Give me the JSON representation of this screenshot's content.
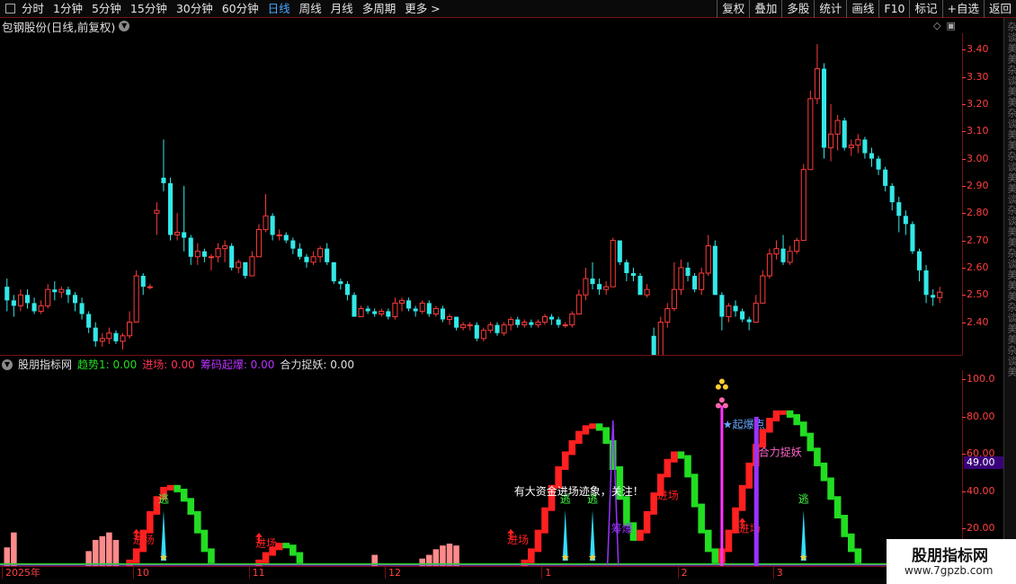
{
  "toolbar": {
    "tabs": [
      {
        "label": "分时",
        "active": false
      },
      {
        "label": "1分钟",
        "active": false
      },
      {
        "label": "5分钟",
        "active": false
      },
      {
        "label": "15分钟",
        "active": false
      },
      {
        "label": "30分钟",
        "active": false
      },
      {
        "label": "60分钟",
        "active": false
      },
      {
        "label": "日线",
        "active": true
      },
      {
        "label": "周线",
        "active": false
      },
      {
        "label": "月线",
        "active": false
      },
      {
        "label": "多周期",
        "active": false
      },
      {
        "label": "更多 >",
        "active": false
      }
    ],
    "actions": [
      "复权",
      "叠加",
      "多股",
      "统计",
      "画线",
      "F10",
      "标记",
      "+自选",
      "返回"
    ]
  },
  "stock": {
    "title": "包钢股份(日线,前复权)"
  },
  "price_axis": {
    "ticks": [
      "3.40",
      "3.30",
      "3.20",
      "3.10",
      "3.00",
      "2.90",
      "2.80",
      "2.70",
      "2.60",
      "2.50",
      "2.40"
    ]
  },
  "indicator": {
    "name": "股朋指标网",
    "fields": [
      {
        "label": "趋势1: 0.00",
        "color": "#22dd22"
      },
      {
        "label": "进场: 0.00",
        "color": "#ff3355"
      },
      {
        "label": "筹码起爆: 0.00",
        "color": "#bb33ff"
      },
      {
        "label": "合力捉妖: 0.00",
        "color": "#e0e0e0"
      }
    ],
    "axis_ticks": [
      "100.0",
      "80.00",
      "60.00",
      "40.00",
      "20.00"
    ],
    "current_value": "49.00",
    "annotations": {
      "enter": "进场",
      "escape": "逃",
      "chip_burst": "筹爆",
      "star_burst": "★起爆点",
      "force": "合力捉妖",
      "notice": "有大资金进场迹象，关注！"
    }
  },
  "dates": {
    "labels": [
      "2025年",
      "10",
      "11",
      "12",
      "1",
      "2",
      "3"
    ]
  },
  "right_strip": {
    "text": "杂谈美美杂谈美美杂谈美美杂谈美美谈杂谈美美杂谈美美美杂谈美美杂谈美"
  },
  "watermark": {
    "title": "股朋指标网",
    "url": "www.7gpzb.com"
  },
  "colors": {
    "up": "#ff3b3b",
    "down": "#33e8e8",
    "axis": "#ff4040",
    "frame": "#7a1010",
    "trend_up": "#ff2020",
    "trend_down": "#22dd22",
    "purple": "#9933ff",
    "magenta": "#ff33ff",
    "volume": "#ff8a8a"
  },
  "chart_data": {
    "type": "candlestick",
    "title": "包钢股份(日线,前复权)",
    "ylim": [
      2.28,
      3.46
    ],
    "y_ticks": [
      2.4,
      2.5,
      2.6,
      2.7,
      2.8,
      2.9,
      3.0,
      3.1,
      3.2,
      3.3,
      3.4
    ],
    "candles": [
      [
        2.53,
        2.48,
        2.56,
        2.44
      ],
      [
        2.48,
        2.46,
        2.5,
        2.42
      ],
      [
        2.46,
        2.5,
        2.52,
        2.44
      ],
      [
        2.5,
        2.47,
        2.52,
        2.45
      ],
      [
        2.47,
        2.44,
        2.49,
        2.43
      ],
      [
        2.44,
        2.46,
        2.48,
        2.43
      ],
      [
        2.46,
        2.52,
        2.54,
        2.45
      ],
      [
        2.52,
        2.51,
        2.55,
        2.48
      ],
      [
        2.51,
        2.52,
        2.53,
        2.49
      ],
      [
        2.52,
        2.5,
        2.53,
        2.47
      ],
      [
        2.5,
        2.47,
        2.51,
        2.44
      ],
      [
        2.47,
        2.43,
        2.49,
        2.41
      ],
      [
        2.43,
        2.38,
        2.44,
        2.36
      ],
      [
        2.38,
        2.33,
        2.4,
        2.31
      ],
      [
        2.33,
        2.34,
        2.36,
        2.31
      ],
      [
        2.34,
        2.36,
        2.38,
        2.32
      ],
      [
        2.36,
        2.33,
        2.37,
        2.32
      ],
      [
        2.33,
        2.35,
        2.36,
        2.3
      ],
      [
        2.35,
        2.4,
        2.44,
        2.34
      ],
      [
        2.4,
        2.57,
        2.59,
        2.4
      ],
      [
        2.57,
        2.53,
        2.58,
        2.5
      ],
      [
        2.53,
        2.53,
        2.54,
        2.52
      ],
      [
        2.8,
        2.81,
        2.84,
        2.72
      ],
      [
        2.93,
        2.91,
        3.07,
        2.88
      ],
      [
        2.91,
        2.72,
        2.93,
        2.7
      ],
      [
        2.72,
        2.73,
        2.8,
        2.7
      ],
      [
        2.73,
        2.71,
        2.9,
        2.66
      ],
      [
        2.71,
        2.64,
        2.72,
        2.61
      ],
      [
        2.64,
        2.66,
        2.69,
        2.61
      ],
      [
        2.66,
        2.64,
        2.67,
        2.62
      ],
      [
        2.64,
        2.64,
        2.65,
        2.59
      ],
      [
        2.64,
        2.67,
        2.69,
        2.62
      ],
      [
        2.67,
        2.68,
        2.7,
        2.62
      ],
      [
        2.68,
        2.6,
        2.69,
        2.59
      ],
      [
        2.6,
        2.62,
        2.63,
        2.58
      ],
      [
        2.62,
        2.57,
        2.62,
        2.56
      ],
      [
        2.57,
        2.64,
        2.66,
        2.57
      ],
      [
        2.64,
        2.74,
        2.76,
        2.64
      ],
      [
        2.74,
        2.79,
        2.87,
        2.73
      ],
      [
        2.79,
        2.72,
        2.8,
        2.7
      ],
      [
        2.72,
        2.72,
        2.74,
        2.7
      ],
      [
        2.72,
        2.7,
        2.73,
        2.69
      ],
      [
        2.7,
        2.67,
        2.71,
        2.65
      ],
      [
        2.67,
        2.64,
        2.69,
        2.63
      ],
      [
        2.64,
        2.62,
        2.65,
        2.6
      ],
      [
        2.62,
        2.64,
        2.66,
        2.61
      ],
      [
        2.64,
        2.67,
        2.68,
        2.62
      ],
      [
        2.67,
        2.62,
        2.69,
        2.61
      ],
      [
        2.62,
        2.55,
        2.62,
        2.54
      ],
      [
        2.55,
        2.54,
        2.56,
        2.52
      ],
      [
        2.54,
        2.5,
        2.55,
        2.48
      ],
      [
        2.5,
        2.42,
        2.51,
        2.42
      ],
      [
        2.42,
        2.45,
        2.46,
        2.42
      ],
      [
        2.45,
        2.44,
        2.46,
        2.43
      ],
      [
        2.44,
        2.43,
        2.45,
        2.42
      ],
      [
        2.43,
        2.44,
        2.45,
        2.42
      ],
      [
        2.44,
        2.42,
        2.45,
        2.41
      ],
      [
        2.42,
        2.47,
        2.49,
        2.41
      ],
      [
        2.47,
        2.48,
        2.49,
        2.44
      ],
      [
        2.48,
        2.45,
        2.49,
        2.44
      ],
      [
        2.45,
        2.44,
        2.46,
        2.42
      ],
      [
        2.44,
        2.47,
        2.48,
        2.43
      ],
      [
        2.47,
        2.43,
        2.48,
        2.42
      ],
      [
        2.43,
        2.45,
        2.46,
        2.42
      ],
      [
        2.45,
        2.41,
        2.46,
        2.4
      ],
      [
        2.41,
        2.42,
        2.43,
        2.39
      ],
      [
        2.42,
        2.38,
        2.42,
        2.37
      ],
      [
        2.38,
        2.39,
        2.4,
        2.37
      ],
      [
        2.39,
        2.39,
        2.4,
        2.37
      ],
      [
        2.39,
        2.34,
        2.4,
        2.33
      ],
      [
        2.34,
        2.37,
        2.38,
        2.33
      ],
      [
        2.37,
        2.39,
        2.4,
        2.36
      ],
      [
        2.39,
        2.36,
        2.4,
        2.35
      ],
      [
        2.36,
        2.39,
        2.4,
        2.35
      ],
      [
        2.39,
        2.41,
        2.42,
        2.37
      ],
      [
        2.41,
        2.39,
        2.42,
        2.38
      ],
      [
        2.39,
        2.4,
        2.41,
        2.38
      ],
      [
        2.4,
        2.39,
        2.41,
        2.38
      ],
      [
        2.39,
        2.4,
        2.41,
        2.38
      ],
      [
        2.4,
        2.42,
        2.43,
        2.39
      ],
      [
        2.42,
        2.41,
        2.43,
        2.39
      ],
      [
        2.41,
        2.39,
        2.42,
        2.38
      ],
      [
        2.39,
        2.39,
        2.4,
        2.38
      ],
      [
        2.39,
        2.43,
        2.44,
        2.38
      ],
      [
        2.43,
        2.5,
        2.52,
        2.43
      ],
      [
        2.5,
        2.56,
        2.6,
        2.48
      ],
      [
        2.56,
        2.54,
        2.62,
        2.52
      ],
      [
        2.54,
        2.52,
        2.56,
        2.5
      ],
      [
        2.52,
        2.53,
        2.55,
        2.5
      ],
      [
        2.53,
        2.7,
        2.71,
        2.53
      ],
      [
        2.7,
        2.62,
        2.7,
        2.61
      ],
      [
        2.62,
        2.58,
        2.63,
        2.55
      ],
      [
        2.58,
        2.57,
        2.6,
        2.55
      ],
      [
        2.57,
        2.5,
        2.58,
        2.5
      ],
      [
        2.5,
        2.52,
        2.54,
        2.49
      ],
      [
        2.35,
        2.22,
        2.38,
        2.2
      ],
      [
        2.22,
        2.4,
        2.42,
        2.21
      ],
      [
        2.4,
        2.45,
        2.47,
        2.38
      ],
      [
        2.45,
        2.52,
        2.62,
        2.44
      ],
      [
        2.52,
        2.6,
        2.63,
        2.5
      ],
      [
        2.6,
        2.57,
        2.62,
        2.55
      ],
      [
        2.57,
        2.52,
        2.58,
        2.51
      ],
      [
        2.52,
        2.58,
        2.6,
        2.5
      ],
      [
        2.58,
        2.68,
        2.72,
        2.57
      ],
      [
        2.68,
        2.5,
        2.7,
        2.5
      ],
      [
        2.5,
        2.42,
        2.51,
        2.37
      ],
      [
        2.42,
        2.46,
        2.47,
        2.4
      ],
      [
        2.46,
        2.44,
        2.48,
        2.42
      ],
      [
        2.44,
        2.41,
        2.45,
        2.4
      ],
      [
        2.41,
        2.4,
        2.42,
        2.37
      ],
      [
        2.4,
        2.47,
        2.5,
        2.4
      ],
      [
        2.47,
        2.57,
        2.59,
        2.47
      ],
      [
        2.57,
        2.65,
        2.67,
        2.56
      ],
      [
        2.65,
        2.67,
        2.7,
        2.63
      ],
      [
        2.67,
        2.62,
        2.72,
        2.61
      ],
      [
        2.62,
        2.66,
        2.68,
        2.61
      ],
      [
        2.66,
        2.7,
        2.71,
        2.65
      ],
      [
        2.7,
        2.96,
        2.98,
        2.7
      ],
      [
        2.96,
        3.22,
        3.25,
        2.96
      ],
      [
        3.22,
        3.33,
        3.42,
        3.2
      ],
      [
        3.33,
        3.04,
        3.35,
        3.0
      ],
      [
        3.04,
        3.09,
        3.2,
        2.99
      ],
      [
        3.09,
        3.14,
        3.16,
        3.03
      ],
      [
        3.14,
        3.04,
        3.15,
        3.03
      ],
      [
        3.04,
        3.05,
        3.07,
        3.01
      ],
      [
        3.05,
        3.07,
        3.09,
        3.02
      ],
      [
        3.07,
        3.02,
        3.08,
        3.0
      ],
      [
        3.02,
        3.0,
        3.04,
        2.97
      ],
      [
        3.0,
        2.96,
        3.01,
        2.94
      ],
      [
        2.96,
        2.9,
        2.97,
        2.88
      ],
      [
        2.9,
        2.84,
        2.91,
        2.81
      ],
      [
        2.84,
        2.79,
        2.86,
        2.73
      ],
      [
        2.79,
        2.76,
        2.81,
        2.72
      ],
      [
        2.76,
        2.66,
        2.77,
        2.65
      ],
      [
        2.66,
        2.59,
        2.67,
        2.55
      ],
      [
        2.59,
        2.5,
        2.61,
        2.47
      ],
      [
        2.5,
        2.49,
        2.52,
        2.46
      ],
      [
        2.49,
        2.51,
        2.53,
        2.47
      ]
    ],
    "indicator": {
      "ylim": [
        0,
        105
      ],
      "trend": [
        0,
        0,
        0,
        0,
        0,
        0,
        0,
        0,
        0,
        0,
        0,
        0,
        0,
        0,
        0,
        0,
        0,
        0,
        2,
        8,
        18,
        28,
        36,
        41,
        42,
        40,
        35,
        28,
        18,
        8,
        2,
        0,
        0,
        0,
        0,
        0,
        0,
        2,
        6,
        9,
        11,
        10,
        6,
        2,
        0,
        0,
        0,
        0,
        0,
        0,
        0,
        0,
        0,
        0,
        0,
        0,
        0,
        0,
        0,
        0,
        0,
        0,
        0,
        0,
        0,
        0,
        0,
        0,
        0,
        0,
        0,
        0,
        0,
        0,
        0,
        0,
        2,
        8,
        18,
        30,
        42,
        52,
        60,
        66,
        71,
        74,
        75,
        73,
        66,
        52,
        36,
        22,
        14,
        18,
        28,
        38,
        48,
        56,
        60,
        58,
        48,
        32,
        18,
        8,
        2,
        8,
        18,
        30,
        42,
        54,
        64,
        72,
        78,
        82,
        82,
        80,
        76,
        70,
        62,
        54,
        46,
        36,
        26,
        16,
        8,
        2
      ],
      "volume": [
        10,
        18,
        0,
        0,
        0,
        0,
        0,
        0,
        0,
        0,
        0,
        0,
        8,
        14,
        16,
        18,
        14,
        0,
        0,
        0,
        0,
        0,
        0,
        0,
        0,
        0,
        0,
        0,
        0,
        0,
        0,
        0,
        0,
        0,
        0,
        0,
        0,
        0,
        0,
        0,
        0,
        0,
        0,
        0,
        0,
        0,
        0,
        0,
        0,
        0,
        0,
        0,
        0,
        0,
        6,
        0,
        0,
        0,
        0,
        0,
        0,
        4,
        6,
        9,
        11,
        12,
        11,
        0,
        0,
        0,
        0,
        0,
        0,
        0,
        0,
        0,
        0,
        0,
        0,
        0,
        0,
        0,
        0,
        0,
        0,
        0,
        0,
        0,
        0,
        0,
        0,
        0,
        0,
        0,
        0,
        0,
        0,
        0,
        0,
        0,
        0,
        0,
        0,
        0,
        0,
        0,
        0,
        0,
        0,
        0,
        0,
        0,
        0,
        0,
        0,
        0,
        0,
        0,
        0,
        0,
        0,
        0,
        0,
        0,
        0,
        0,
        0,
        0,
        0,
        0,
        0,
        0
      ]
    }
  }
}
